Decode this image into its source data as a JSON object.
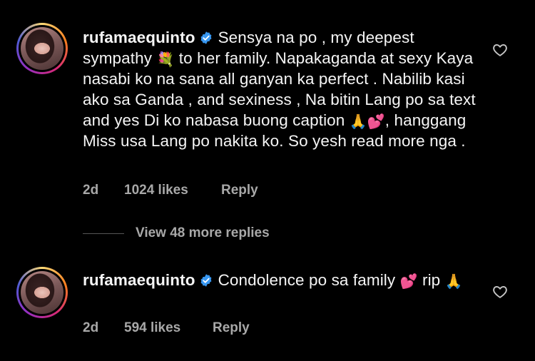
{
  "comments": [
    {
      "username": "rufamaequinto",
      "text_part1": "Sensya na po , my deepest sympathy ",
      "emoji1": "💐",
      "text_part2": " to her family. Napakaganda at sexy Kaya nasabi ko na sana all ganyan ka perfect . Nabilib kasi ako sa Ganda , and sexiness , Na bitin Lang po sa text and yes Di ko nabasa buong caption ",
      "emoji2": "🙏💕",
      "text_part3": ", hanggang Miss usa Lang po nakita ko. So yesh read more nga .",
      "time": "2d",
      "likes": "1024 likes",
      "reply_label": "Reply"
    },
    {
      "username": "rufamaequinto",
      "text_part1": "Condolence po sa family ",
      "emoji1": "💕",
      "text_part2": " rip ",
      "emoji2": "🙏",
      "text_part3": "",
      "time": "2d",
      "likes": "594 likes",
      "reply_label": "Reply"
    }
  ],
  "view_more_replies": "View 48 more replies",
  "icons": {
    "verified": "verified-badge-icon",
    "like": "heart-outline-icon"
  },
  "colors": {
    "background": "#000000",
    "text": "#f5f5f5",
    "muted": "#a8a8a8",
    "verified": "#3897f0"
  }
}
